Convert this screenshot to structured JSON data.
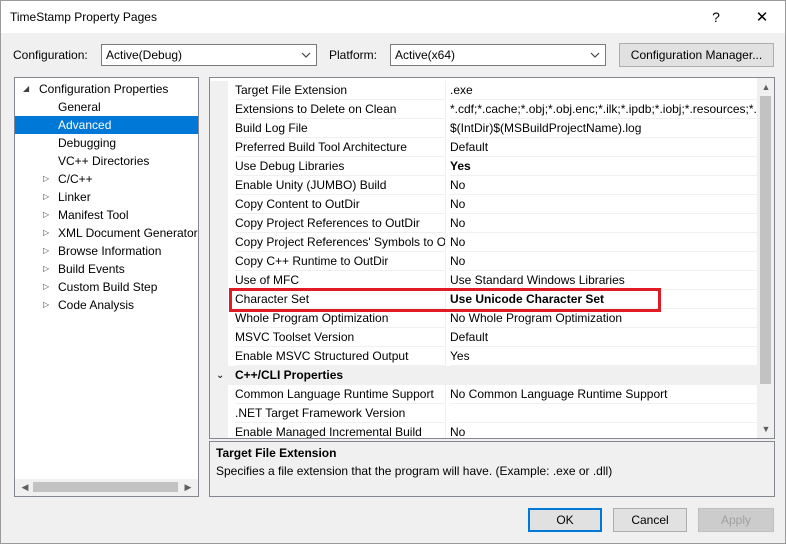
{
  "window": {
    "title": "TimeStamp Property Pages",
    "help_label": "?",
    "close_label": "✕"
  },
  "toolbar": {
    "configuration_label": "Configuration:",
    "configuration_value": "Active(Debug)",
    "platform_label": "Platform:",
    "platform_value": "Active(x64)",
    "config_manager_label": "Configuration Manager..."
  },
  "tree": {
    "root": "Configuration Properties",
    "items": [
      {
        "label": "General",
        "expandable": false,
        "selected": false
      },
      {
        "label": "Advanced",
        "expandable": false,
        "selected": true
      },
      {
        "label": "Debugging",
        "expandable": false,
        "selected": false
      },
      {
        "label": "VC++ Directories",
        "expandable": false,
        "selected": false
      },
      {
        "label": "C/C++",
        "expandable": true,
        "selected": false
      },
      {
        "label": "Linker",
        "expandable": true,
        "selected": false
      },
      {
        "label": "Manifest Tool",
        "expandable": true,
        "selected": false
      },
      {
        "label": "XML Document Generator",
        "expandable": true,
        "selected": false
      },
      {
        "label": "Browse Information",
        "expandable": true,
        "selected": false
      },
      {
        "label": "Build Events",
        "expandable": true,
        "selected": false
      },
      {
        "label": "Custom Build Step",
        "expandable": true,
        "selected": false
      },
      {
        "label": "Code Analysis",
        "expandable": true,
        "selected": false
      }
    ]
  },
  "grid": {
    "rows": [
      {
        "name": "Target File Extension",
        "value": ".exe",
        "bold": false
      },
      {
        "name": "Extensions to Delete on Clean",
        "value": "*.cdf;*.cache;*.obj;*.obj.enc;*.ilk;*.ipdb;*.iobj;*.resources;*.t",
        "bold": false
      },
      {
        "name": "Build Log File",
        "value": "$(IntDir)$(MSBuildProjectName).log",
        "bold": false
      },
      {
        "name": "Preferred Build Tool Architecture",
        "value": "Default",
        "bold": false
      },
      {
        "name": "Use Debug Libraries",
        "value": "Yes",
        "bold": true
      },
      {
        "name": "Enable Unity (JUMBO) Build",
        "value": "No",
        "bold": false
      },
      {
        "name": "Copy Content to OutDir",
        "value": "No",
        "bold": false
      },
      {
        "name": "Copy Project References to OutDir",
        "value": "No",
        "bold": false
      },
      {
        "name": "Copy Project References' Symbols to Ou",
        "value": "No",
        "bold": false
      },
      {
        "name": "Copy C++ Runtime to OutDir",
        "value": "No",
        "bold": false
      },
      {
        "name": "Use of MFC",
        "value": "Use Standard Windows Libraries",
        "bold": false
      },
      {
        "name": "Character Set",
        "value": "Use Unicode Character Set",
        "bold": true
      },
      {
        "name": "Whole Program Optimization",
        "value": "No Whole Program Optimization",
        "bold": false
      },
      {
        "name": "MSVC Toolset Version",
        "value": "Default",
        "bold": false
      },
      {
        "name": "Enable MSVC Structured Output",
        "value": "Yes",
        "bold": false
      }
    ],
    "category": "C++/CLI Properties",
    "category_rows": [
      {
        "name": "Common Language Runtime Support",
        "value": "No Common Language Runtime Support",
        "bold": false
      },
      {
        "name": ".NET Target Framework Version",
        "value": "",
        "bold": false
      },
      {
        "name": "Enable Managed Incremental Build",
        "value": "No",
        "bold": false
      }
    ]
  },
  "description": {
    "title": "Target File Extension",
    "text": "Specifies a file extension that the program will have. (Example: .exe or .dll)"
  },
  "buttons": {
    "ok": "OK",
    "cancel": "Cancel",
    "apply": "Apply"
  },
  "colors": {
    "accent": "#0078d7",
    "highlight": "#e01b24"
  }
}
